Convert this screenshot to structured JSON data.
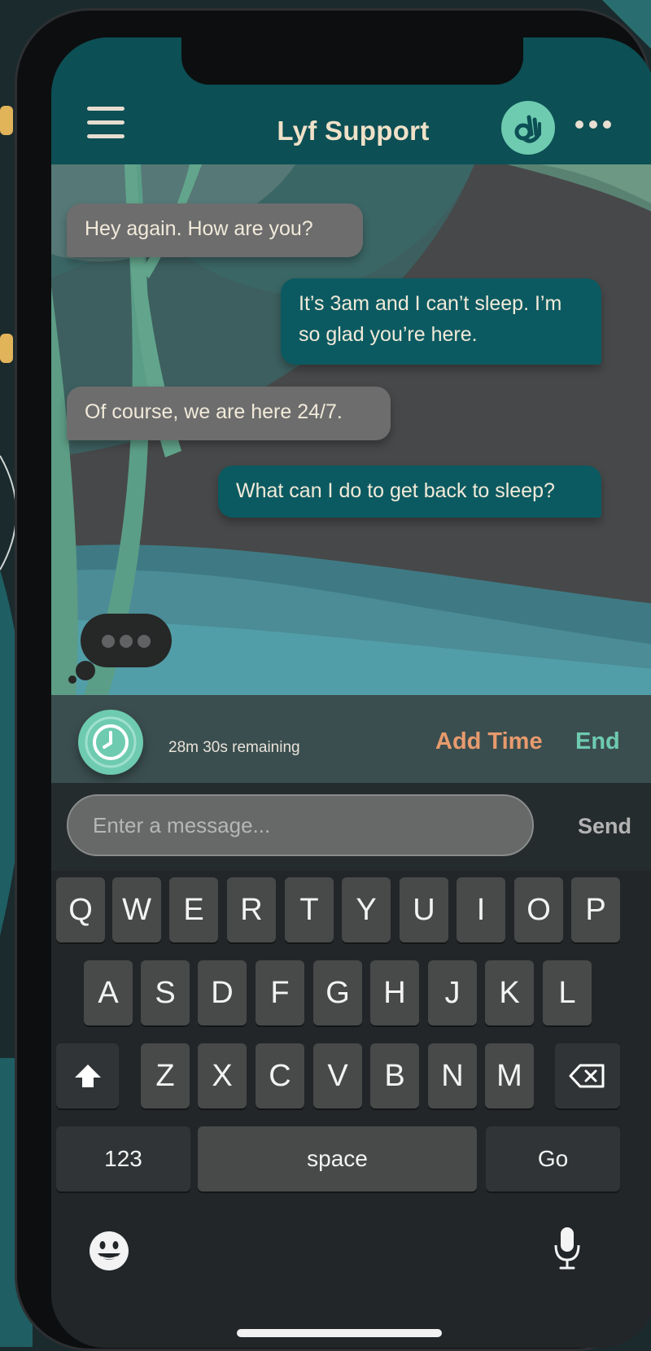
{
  "app": {
    "title": "Lyf Support",
    "colors": {
      "header": "#0c4f55",
      "accent_mint": "#6ecbb0",
      "add_time": "#e89a6e",
      "incoming_bubble": "#6d6d6e",
      "outgoing_bubble": "#0c5a61"
    }
  },
  "header": {
    "menu_icon": "hamburger-menu-icon",
    "avatar_icon": "ok-hand-icon",
    "more_icon": "more-dots-icon"
  },
  "messages": [
    {
      "sender": "support",
      "text": "Hey again. How are you?"
    },
    {
      "sender": "user",
      "lines": [
        "It’s 3am and I can’t sleep. I’m",
        "so glad you’re here."
      ]
    },
    {
      "sender": "support",
      "text": "Of course, we are here 24/7."
    },
    {
      "sender": "user",
      "text": "What can I do to get back to sleep?"
    }
  ],
  "typing_indicator": {
    "icon": "typing-dots-icon"
  },
  "session": {
    "remaining": "28m 30s remaining",
    "add_time_label": "Add Time",
    "end_label": "End",
    "timer_icon": "clock-icon"
  },
  "composer": {
    "placeholder": "Enter a message...",
    "value": "",
    "send_label": "Send"
  },
  "keyboard": {
    "row1": [
      "Q",
      "W",
      "E",
      "R",
      "T",
      "Y",
      "U",
      "I",
      "O",
      "P"
    ],
    "row2": [
      "A",
      "S",
      "D",
      "F",
      "G",
      "H",
      "J",
      "K",
      "L"
    ],
    "row3": [
      "Z",
      "X",
      "C",
      "V",
      "B",
      "N",
      "M"
    ],
    "numbers_label": "123",
    "space_label": "space",
    "go_label": "Go",
    "icons": {
      "shift": "shift-icon",
      "backspace": "backspace-icon",
      "emoji": "emoji-icon",
      "mic": "microphone-icon"
    }
  }
}
